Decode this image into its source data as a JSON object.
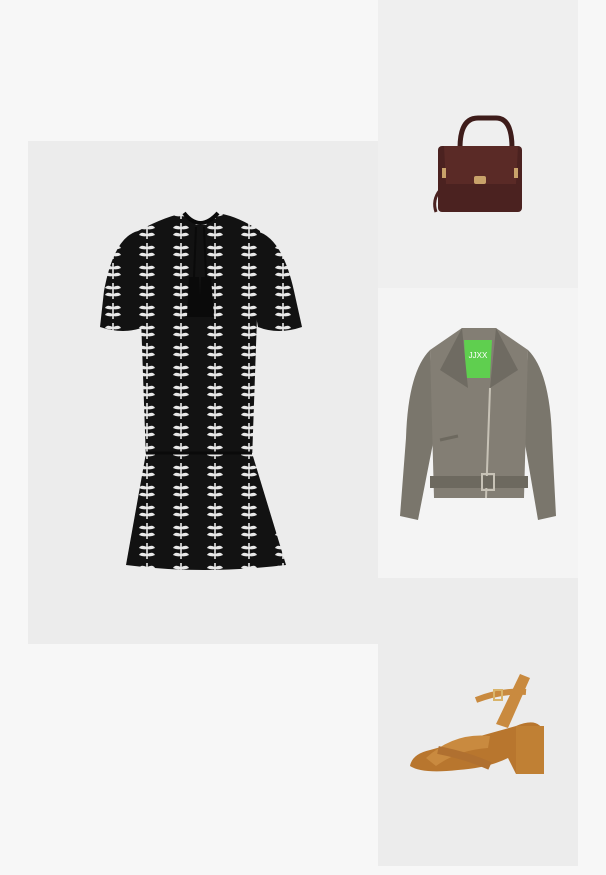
{
  "jacket": {
    "label_text": "JJXX"
  }
}
